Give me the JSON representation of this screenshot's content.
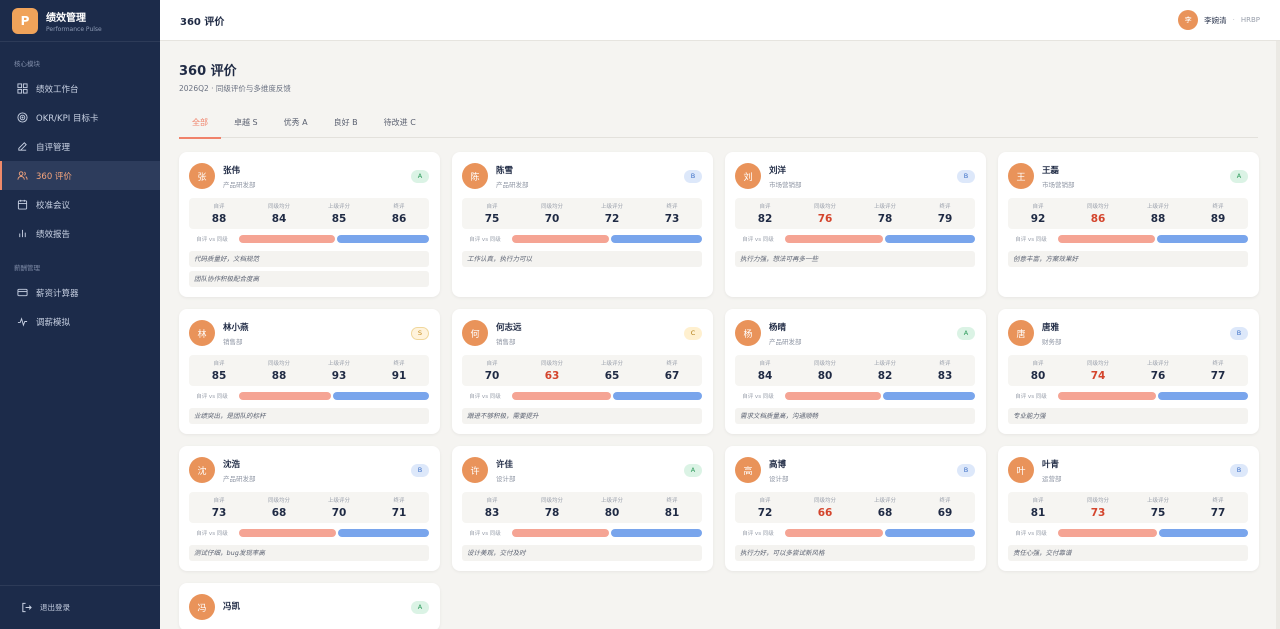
{
  "brand": {
    "logo": "P",
    "title": "绩效管理",
    "subtitle": "Performance Pulse"
  },
  "sidebar": {
    "section1": "核心模块",
    "items": [
      {
        "label": "绩效工作台",
        "icon": "dashboard-icon"
      },
      {
        "label": "OKR/KPI 目标卡",
        "icon": "target-icon"
      },
      {
        "label": "自评管理",
        "icon": "edit-icon"
      },
      {
        "label": "360 评价",
        "icon": "users-icon"
      },
      {
        "label": "校准会议",
        "icon": "calendar-icon"
      },
      {
        "label": "绩效报告",
        "icon": "bar-chart-icon"
      }
    ],
    "section2": "薪酬管理",
    "items2": [
      {
        "label": "薪资计算器",
        "icon": "card-icon"
      },
      {
        "label": "调薪模拟",
        "icon": "pulse-icon"
      }
    ],
    "logout": "退出登录"
  },
  "topbar": {
    "title": "360 评价",
    "user_avatar": "李",
    "user_name": "李婉清",
    "user_sep": "·",
    "user_role": "HRBP"
  },
  "page": {
    "title": "360 评价",
    "subtitle": "2026Q2 · 同级评价与多维度反馈"
  },
  "tabs": [
    "全部",
    "卓越 S",
    "优秀 A",
    "良好 B",
    "待改进 C"
  ],
  "labels": {
    "self": "自评",
    "peer": "同级均分",
    "boss": "上级评分",
    "final": "终评",
    "compare": "自评 vs 同级"
  },
  "colors": {
    "accent": "#f0826a",
    "self_bar": "#f5a494",
    "peer_bar": "#79a5ec",
    "warn": "#d4452d",
    "sidebar": "#1c2b4a"
  },
  "cards": [
    {
      "avatar": "张",
      "name": "张伟",
      "dept": "产品研发部",
      "grade": "A",
      "self": 88,
      "peer": 84,
      "boss": 85,
      "final": 86,
      "comments": [
        "代码质量好，文档规范",
        "团队协作积极配合度高"
      ]
    },
    {
      "avatar": "陈",
      "name": "陈雪",
      "dept": "产品研发部",
      "grade": "B",
      "self": 75,
      "peer": 70,
      "boss": 72,
      "final": 73,
      "comments": [
        "工作认真，执行力可以"
      ]
    },
    {
      "avatar": "刘",
      "name": "刘洋",
      "dept": "市场营销部",
      "grade": "B",
      "self": 82,
      "peer": 76,
      "boss": 78,
      "final": 79,
      "comments": [
        "执行力强，想法可再多一些"
      ]
    },
    {
      "avatar": "王",
      "name": "王磊",
      "dept": "市场营销部",
      "grade": "A",
      "self": 92,
      "peer": 86,
      "boss": 88,
      "final": 89,
      "comments": [
        "创意丰富，方案效果好"
      ]
    },
    {
      "avatar": "林",
      "name": "林小燕",
      "dept": "销售部",
      "grade": "S",
      "self": 85,
      "peer": 88,
      "boss": 93,
      "final": 91,
      "comments": [
        "业绩突出，是团队的标杆"
      ]
    },
    {
      "avatar": "何",
      "name": "何志远",
      "dept": "销售部",
      "grade": "C",
      "self": 70,
      "peer": 63,
      "boss": 65,
      "final": 67,
      "comments": [
        "跟进不够积极，需要提升"
      ]
    },
    {
      "avatar": "杨",
      "name": "杨晴",
      "dept": "产品研发部",
      "grade": "A",
      "self": 84,
      "peer": 80,
      "boss": 82,
      "final": 83,
      "comments": [
        "需求文档质量高，沟通顺畅"
      ]
    },
    {
      "avatar": "唐",
      "name": "唐雅",
      "dept": "财务部",
      "grade": "B",
      "self": 80,
      "peer": 74,
      "boss": 76,
      "final": 77,
      "comments": [
        "专业能力强"
      ]
    },
    {
      "avatar": "沈",
      "name": "沈浩",
      "dept": "产品研发部",
      "grade": "B",
      "self": 73,
      "peer": 68,
      "boss": 70,
      "final": 71,
      "comments": [
        "测试仔细，bug发现率高"
      ]
    },
    {
      "avatar": "许",
      "name": "许佳",
      "dept": "设计部",
      "grade": "A",
      "self": 83,
      "peer": 78,
      "boss": 80,
      "final": 81,
      "comments": [
        "设计美观，交付及时"
      ]
    },
    {
      "avatar": "高",
      "name": "高博",
      "dept": "设计部",
      "grade": "B",
      "self": 72,
      "peer": 66,
      "boss": 68,
      "final": 69,
      "comments": [
        "执行力好，可以多尝试新风格"
      ]
    },
    {
      "avatar": "叶",
      "name": "叶青",
      "dept": "运营部",
      "grade": "B",
      "self": 81,
      "peer": 73,
      "boss": 75,
      "final": 77,
      "comments": [
        "责任心强，交付靠谱"
      ]
    },
    {
      "avatar": "冯",
      "name": "冯凯",
      "dept": "",
      "grade": "A",
      "self": null,
      "peer": null,
      "boss": null,
      "final": null,
      "comments": []
    }
  ]
}
